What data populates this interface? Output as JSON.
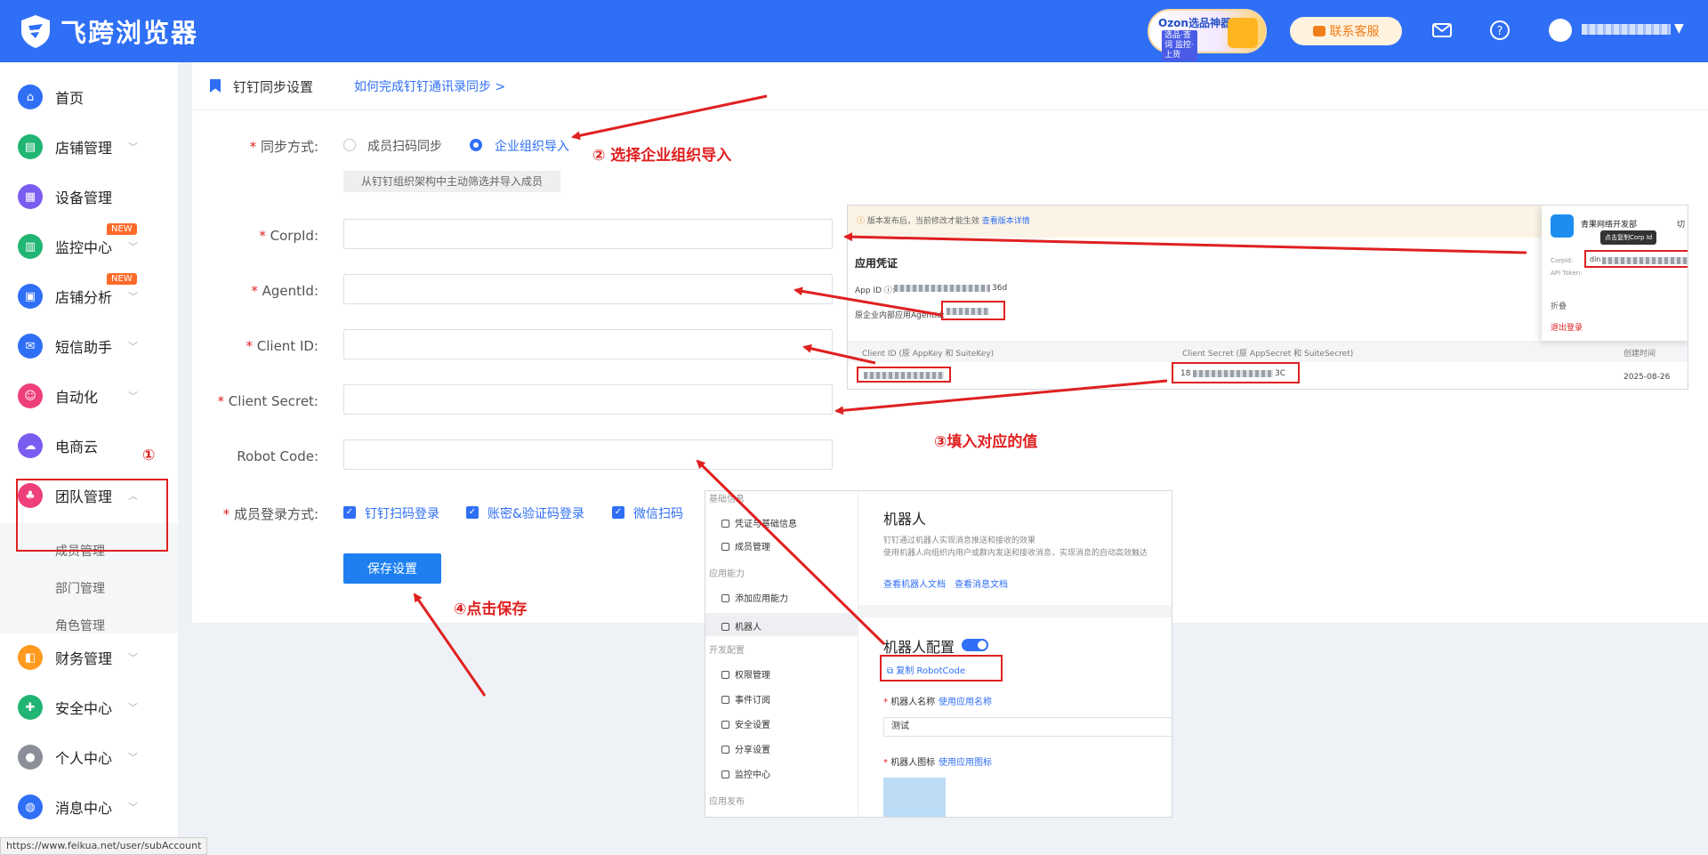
{
  "app": {
    "name": "飞跨浏览器"
  },
  "topbar": {
    "ozon_title": "Ozon选品神器",
    "ozon_sub": "选品·查词 监控·上货",
    "contact_label": "联系客服",
    "mail_icon": "mail-icon",
    "help_icon": "help-icon"
  },
  "sidebar": {
    "items": [
      {
        "label": "首页",
        "icon": "home-icon",
        "color": "#2f6ff5"
      },
      {
        "label": "店铺管理",
        "icon": "store-icon",
        "color": "#21b573"
      },
      {
        "label": "设备管理",
        "icon": "device-icon",
        "color": "#7b5cf0"
      },
      {
        "label": "监控中心",
        "icon": "monitor-icon",
        "color": "#21b573",
        "badge": "NEW"
      },
      {
        "label": "店铺分析",
        "icon": "analysis-icon",
        "color": "#2f6ff5",
        "badge": "NEW"
      },
      {
        "label": "短信助手",
        "icon": "sms-icon",
        "color": "#2f6ff5"
      },
      {
        "label": "自动化",
        "icon": "robot-icon",
        "color": "#ee3f7a"
      },
      {
        "label": "电商云",
        "icon": "cloud-icon",
        "color": "#7b5cf0"
      },
      {
        "label": "团队管理",
        "icon": "team-icon",
        "color": "#ee3f7a"
      },
      {
        "label": "财务管理",
        "icon": "wallet-icon",
        "color": "#ff9a1f"
      },
      {
        "label": "安全中心",
        "icon": "shield-icon",
        "color": "#21b573"
      },
      {
        "label": "个人中心",
        "icon": "user-icon",
        "color": "#8a8f99"
      },
      {
        "label": "消息中心",
        "icon": "bell-icon",
        "color": "#2f6ff5"
      }
    ],
    "sub_items": [
      "成员管理",
      "部门管理",
      "角色管理"
    ]
  },
  "page": {
    "title": "钉钉同步设置",
    "help_link": "如何完成钉钉通讯录同步 >"
  },
  "form": {
    "sync_label": "同步方式:",
    "sync_options": [
      "成员扫码同步",
      "企业组织导入"
    ],
    "sync_selected": "企业组织导入",
    "sync_hint": "从钉钉组织架构中主动筛选并导入成员",
    "fields": [
      {
        "label": "CorpId:",
        "required": true,
        "value": ""
      },
      {
        "label": "AgentId:",
        "required": true,
        "value": ""
      },
      {
        "label": "Client ID:",
        "required": true,
        "value": ""
      },
      {
        "label": "Client Secret:",
        "required": true,
        "value": ""
      },
      {
        "label": "Robot Code:",
        "required": false,
        "value": ""
      }
    ],
    "login_label": "成员登录方式:",
    "login_options": [
      {
        "label": "钉钉扫码登录",
        "checked": true
      },
      {
        "label": "账密&验证码登录",
        "checked": true
      },
      {
        "label": "微信扫码",
        "checked": true
      }
    ],
    "save_label": "保存设置"
  },
  "annotations": {
    "step1": "①",
    "step2": "② 选择企业组织导入",
    "step3": "③填入对应的值",
    "step4": "④点击保存"
  },
  "shot1": {
    "banner": "版本发布后，当前修改才能生效",
    "banner_link": "查看版本详情",
    "section": "应用凭证",
    "app_id_label": "App ID ⓘ:",
    "app_id_suffix": "36d",
    "agent_label": "原企业内部应用AgentId:",
    "client_id_head": "Client ID (原 AppKey 和 SuiteKey)",
    "client_secret_head": "Client Secret (原 AppSecret 和 SuiteSecret)",
    "created_head": "创建时间",
    "secret_prefix": "18",
    "secret_suffix": "3C",
    "created_date": "2025-08-26",
    "org_name": "青果网络开发部",
    "switch": "切",
    "tooltip": "点击复制Corp Id",
    "corpid_label": "CorpId:",
    "corpid_prefix": "din",
    "api_token_label": "API Token:",
    "collapse": "折叠",
    "logout": "退出登录"
  },
  "shot2": {
    "groups": [
      "基础信息",
      "应用能力",
      "开发配置",
      "应用发布"
    ],
    "items": [
      "凭证与基础信息",
      "成员管理",
      "添加应用能力",
      "机器人",
      "权限管理",
      "事件订阅",
      "安全设置",
      "分享设置",
      "监控中心"
    ],
    "title": "机器人",
    "desc1": "钉钉通过机器人实现消息推送和接收的效果",
    "desc2": "使用机器人向组织内用户或群内发送和接收消息，实现消息的自动高效触达",
    "doc1": "查看机器人文档",
    "doc2": "查看消息文档",
    "config_title": "机器人配置",
    "copy_robot": "复制 RobotCode",
    "name_label": "机器人名称",
    "use_app_name": "使用应用名称",
    "name_value": "测试",
    "icon_label": "机器人图标",
    "use_app_icon": "使用应用图标"
  },
  "status_url": "https://www.feikua.net/user/subAccount",
  "colors": {
    "brand": "#2f6ff5",
    "annotation": "#e02020"
  }
}
